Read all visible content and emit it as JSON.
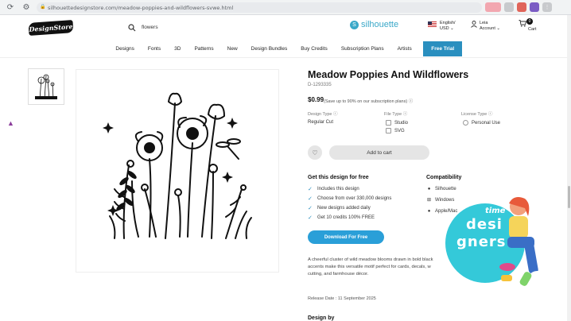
{
  "browser": {
    "url": "silhouettedesignstore.com/meadow-poppies-and-wildflowers-svwe.html"
  },
  "header": {
    "logo_text": "DesignStore",
    "search_value": "flowers",
    "brand": "silhouette",
    "lang_line1": "English/",
    "lang_line2": "USD",
    "user_name": "Leia",
    "user_account": "Account",
    "cart_count": "0",
    "cart_label": "Cart"
  },
  "nav": {
    "items": [
      "Designs",
      "Fonts",
      "3D",
      "Patterns",
      "New",
      "Design Bundles",
      "Buy Credits",
      "Subscription Plans",
      "Artists"
    ],
    "cta": "Free Trial"
  },
  "product": {
    "title": "Meadow Poppies And Wildflowers",
    "sku": "D-1293335",
    "price": "$0.99",
    "price_note": "(Save up to 90% on our subscription plans)",
    "design_type_label": "Design Type",
    "design_type_value": "Regular Cut",
    "file_type_label": "File Type",
    "file_types": [
      "Studio",
      "SVG"
    ],
    "license_type_label": "License Type",
    "license_value": "Personal Use",
    "add_to_cart": "Add to cart"
  },
  "free": {
    "heading": "Get this design for free",
    "features": [
      "Includes this design",
      "Choose from over 330,000 designs",
      "New designs added daily",
      "Get 10 credits 100% FREE"
    ],
    "download_label": "Download For Free"
  },
  "compatibility": {
    "heading": "Compatibility",
    "items": [
      "Silhouette",
      "Windows",
      "Apple/Mac"
    ]
  },
  "description": "A cheerful cluster of wild meadow blooms drawn in bold black line art. Delicate accents make this versatile motif perfect for cards, decals, wall art, cutting, and farmhouse décor.",
  "description_visible": "A cheerful cluster of wild meadow blooms drawn in bold black",
  "description_line2": "accents make this versatile motif perfect for cards, decals, w",
  "description_line3": "cutting, and farmhouse décor.",
  "release_date": "Release Date : 11 September 2025",
  "design_by": "Design by",
  "overlay": {
    "time": "time",
    "line1": "des",
    "line2": "igners",
    "line3_a": "de",
    "word_parts": [
      "desi",
      "gners"
    ],
    "color": "#34c9d9"
  },
  "colors": {
    "accent": "#2a8fbf",
    "download": "#2a9fd8"
  }
}
